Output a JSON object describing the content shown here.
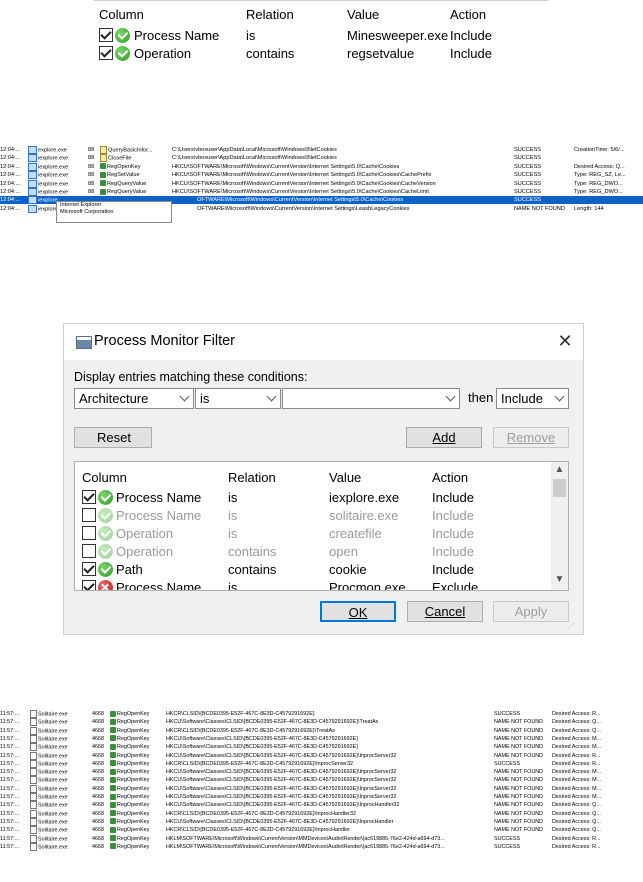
{
  "top_filter": {
    "headers": {
      "column": "Column",
      "relation": "Relation",
      "value": "Value",
      "action": "Action"
    },
    "rows": [
      {
        "column": "Process Name",
        "relation": "is",
        "value": "Minesweeper.exe",
        "action": "Include",
        "checked": true
      },
      {
        "column": "Operation",
        "relation": "contains",
        "value": "regsetvalue",
        "action": "Include",
        "checked": true
      }
    ]
  },
  "explorer_events": [
    {
      "time": "12:04:...",
      "process": "explore.exe",
      "pid": "88",
      "operation": "QueryBasicInfor...",
      "path": "C:\\Users\\vboxuser\\AppData\\Local\\Microsoft\\Windows\\INetCookies",
      "result": "SUCCESS",
      "detail": "CreationTime: 5/6/...",
      "icon": "file"
    },
    {
      "time": "12:04:...",
      "process": "iexplore.exe",
      "pid": "88",
      "operation": "CloseFile",
      "path": "C:\\Users\\vboxuser\\AppData\\Local\\Microsoft\\Windows\\INetCookies",
      "result": "SUCCESS",
      "detail": "",
      "icon": "file"
    },
    {
      "time": "12:04:...",
      "process": "iexplore.exe",
      "pid": "88",
      "operation": "RegOpenKey",
      "path": "HKCU\\SOFTWARE\\Microsoft\\Windows\\CurrentVersion\\Internet Settings\\5.0\\Cache\\Cookies",
      "result": "SUCCESS",
      "detail": "Desired Access: Q...",
      "icon": "reg"
    },
    {
      "time": "12:04:...",
      "process": "iexplore.exe",
      "pid": "88",
      "operation": "RegSetValue",
      "path": "HKCU\\SOFTWARE\\Microsoft\\Windows\\CurrentVersion\\Internet Settings\\5.0\\Cache\\Cookies\\CachePrefix",
      "result": "SUCCESS",
      "detail": "Type: REG_SZ, Le...",
      "icon": "reg"
    },
    {
      "time": "12:04:...",
      "process": "iexplore.exe",
      "pid": "88",
      "operation": "RegQueryValue",
      "path": "HKCU\\SOFTWARE\\Microsoft\\Windows\\CurrentVersion\\Internet Settings\\5.0\\Cache\\Cookies\\CacheVersion",
      "result": "SUCCESS",
      "detail": "Type: REG_DWO...",
      "icon": "reg"
    },
    {
      "time": "12:04:...",
      "process": "iexplore.exe",
      "pid": "88",
      "operation": "RegQueryValue",
      "path": "HKCU\\SOFTWARE\\Microsoft\\Windows\\CurrentVersion\\Internet Settings\\5.0\\Cache\\Cookies\\CacheLimit",
      "result": "SUCCESS",
      "detail": "Type: REG_DWO...",
      "icon": "reg"
    },
    {
      "time": "12:04:...",
      "process": "iexplore",
      "pid": "",
      "operation": "",
      "path": "OFTWARE\\Microsoft\\Windows\\CurrentVersion\\Internet Settings\\5.0\\Cache\\Cookies",
      "result": "SUCCESS",
      "detail": "",
      "icon": "proc",
      "selected": true
    },
    {
      "time": "12:04:...",
      "process": "iexplore",
      "pid": "",
      "operation": "",
      "path": "OFTWARE\\Microsoft\\Windows\\CurrentVersion\\Internet Settings\\LeashLegacyCookies",
      "result": "NAME NOT FOUND",
      "detail": "Length: 144",
      "icon": "proc"
    }
  ],
  "tooltip": {
    "line1": "Internet Explorer",
    "line2": "Microsoft Corporation"
  },
  "dialog": {
    "title": "Process Monitor Filter",
    "close_glyph": "✕",
    "instruction": "Display entries matching these conditions:",
    "column_combo": "Architecture",
    "relation_combo": "is",
    "value_combo": "",
    "then_label": "then",
    "action_combo": "Include",
    "reset_label": "Reset",
    "add_label": "Add",
    "remove_label": "Remove",
    "ok_label": "OK",
    "cancel_label": "Cancel",
    "apply_label": "Apply",
    "headers": {
      "column": "Column",
      "relation": "Relation",
      "value": "Value",
      "action": "Action"
    },
    "rules": [
      {
        "column": "Process Name",
        "relation": "is",
        "value": "iexplore.exe",
        "action": "Include",
        "checked": true,
        "icon": "ok"
      },
      {
        "column": "Process Name",
        "relation": "is",
        "value": "solitaire.exe",
        "action": "Include",
        "checked": false,
        "icon": "ok"
      },
      {
        "column": "Operation",
        "relation": "is",
        "value": "createfile",
        "action": "Include",
        "checked": false,
        "icon": "ok"
      },
      {
        "column": "Operation",
        "relation": "contains",
        "value": "open",
        "action": "Include",
        "checked": false,
        "icon": "ok"
      },
      {
        "column": "Path",
        "relation": "contains",
        "value": "cookie",
        "action": "Include",
        "checked": true,
        "icon": "ok"
      },
      {
        "column": "Process Name",
        "relation": "is",
        "value": "Procmon.exe",
        "action": "Exclude",
        "checked": true,
        "icon": "x"
      }
    ]
  },
  "solitaire_events": [
    {
      "time": "11:57:...",
      "process": "Solitaire.exe",
      "pid": "4668",
      "operation": "RegOpenKey",
      "path": "HKCR\\CLSID\\{BCDE0395-E52F-467C-8E3D-C4579291692E}",
      "result": "SUCCESS",
      "detail": "Desired Access: R..."
    },
    {
      "time": "11:57:...",
      "process": "Solitaire.exe",
      "pid": "4668",
      "operation": "RegOpenKey",
      "path": "HKCU\\Software\\Classes\\CLSID\\{BCDE0395-E52F-467C-8E3D-C4579291692E}\\TreatAs",
      "result": "NAME NOT FOUND",
      "detail": "Desired Access: Q..."
    },
    {
      "time": "11:57:...",
      "process": "Solitaire.exe",
      "pid": "4668",
      "operation": "RegOpenKey",
      "path": "HKCR\\CLSID\\{BCDE0395-E52F-467C-8E3D-C4579291692E}\\TreatAs",
      "result": "NAME NOT FOUND",
      "detail": "Desired Access: Q..."
    },
    {
      "time": "11:57:...",
      "process": "Solitaire.exe",
      "pid": "4668",
      "operation": "RegOpenKey",
      "path": "HKCU\\Software\\Classes\\CLSID\\{BCDE0395-E52F-467C-8E3D-C4579291692E}",
      "result": "NAME NOT FOUND",
      "detail": "Desired Access: M..."
    },
    {
      "time": "11:57:...",
      "process": "Solitaire.exe",
      "pid": "4668",
      "operation": "RegOpenKey",
      "path": "HKCU\\Software\\Classes\\CLSID\\{BCDE0395-E52F-467C-8E3D-C4579291692E}",
      "result": "NAME NOT FOUND",
      "detail": "Desired Access: M..."
    },
    {
      "time": "11:57:...",
      "process": "Solitaire.exe",
      "pid": "4668",
      "operation": "RegOpenKey",
      "path": "HKCU\\Software\\Classes\\CLSID\\{BCDE0395-E52F-467C-8E3D-C4579291692E}\\InprocServer32",
      "result": "NAME NOT FOUND",
      "detail": "Desired Access: R..."
    },
    {
      "time": "11:57:...",
      "process": "Solitaire.exe",
      "pid": "4668",
      "operation": "RegOpenKey",
      "path": "HKCR\\CLSID\\{BCDE0395-E52F-467C-8E3D-C4579291692E}\\InprocServer32",
      "result": "SUCCESS",
      "detail": "Desired Access: R..."
    },
    {
      "time": "11:57:...",
      "process": "Solitaire.exe",
      "pid": "4668",
      "operation": "RegOpenKey",
      "path": "HKCU\\Software\\Classes\\CLSID\\{BCDE0395-E52F-467C-8E3D-C4579291692E}\\InprocServer32",
      "result": "NAME NOT FOUND",
      "detail": "Desired Access: M..."
    },
    {
      "time": "11:57:...",
      "process": "Solitaire.exe",
      "pid": "4668",
      "operation": "RegOpenKey",
      "path": "HKCU\\Software\\Classes\\CLSID\\{BCDE0395-E52F-467C-8E3D-C4579291692E}\\InprocServer32",
      "result": "NAME NOT FOUND",
      "detail": "Desired Access: M..."
    },
    {
      "time": "11:57:...",
      "process": "Solitaire.exe",
      "pid": "4668",
      "operation": "RegOpenKey",
      "path": "HKCU\\Software\\Classes\\CLSID\\{BCDE0395-E52F-467C-8E3D-C4579291692E}\\InprocServer32",
      "result": "NAME NOT FOUND",
      "detail": "Desired Access: M..."
    },
    {
      "time": "11:57:...",
      "process": "Solitaire.exe",
      "pid": "4668",
      "operation": "RegOpenKey",
      "path": "HKCU\\Software\\Classes\\CLSID\\{BCDE0395-E52F-467C-8E3D-C4579291692E}\\InprocServer32",
      "result": "NAME NOT FOUND",
      "detail": "Desired Access: M..."
    },
    {
      "time": "11:57:...",
      "process": "Solitaire.exe",
      "pid": "4668",
      "operation": "RegOpenKey",
      "path": "HKCU\\Software\\Classes\\CLSID\\{BCDE0395-E52F-467C-8E3D-C4579291692E}\\InprocHandler32",
      "result": "NAME NOT FOUND",
      "detail": "Desired Access: Q..."
    },
    {
      "time": "11:57:...",
      "process": "Solitaire.exe",
      "pid": "4668",
      "operation": "RegOpenKey",
      "path": "HKCR\\CLSID\\{BCDE0395-E52F-467C-8E3D-C4579291692E}\\InprocHandler32",
      "result": "NAME NOT FOUND",
      "detail": "Desired Access: Q..."
    },
    {
      "time": "11:57:...",
      "process": "Solitaire.exe",
      "pid": "4668",
      "operation": "RegOpenKey",
      "path": "HKCU\\Software\\Classes\\CLSID\\{BCDE0395-E52F-467C-8E3D-C4579291692E}\\InprocHandler",
      "result": "NAME NOT FOUND",
      "detail": "Desired Access: Q..."
    },
    {
      "time": "11:57:...",
      "process": "Solitaire.exe",
      "pid": "4668",
      "operation": "RegOpenKey",
      "path": "HKCR\\CLSID\\{BCDE0395-E52F-467C-8E3D-C4579291692E}\\InprocHandler",
      "result": "NAME NOT FOUND",
      "detail": "Desired Access: Q..."
    },
    {
      "time": "11:57:...",
      "process": "Solitaire.exe",
      "pid": "4668",
      "operation": "RegOpenKey",
      "path": "HKLM\\SOFTWARE\\Microsoft\\Windows\\CurrentVersion\\MMDevices\\Audio\\Render\\{ac619885-76e2-424d-a694-d73...",
      "result": "SUCCESS",
      "detail": "Desired Access: R..."
    },
    {
      "time": "11:57:...",
      "process": "Solitaire.exe",
      "pid": "4668",
      "operation": "RegOpenKey",
      "path": "HKLM\\SOFTWARE\\Microsoft\\Windows\\CurrentVersion\\MMDevices\\Audio\\Render\\{ac619885-76e2-424d-a694-d73...",
      "result": "SUCCESS",
      "detail": "Desired Access: R..."
    }
  ]
}
